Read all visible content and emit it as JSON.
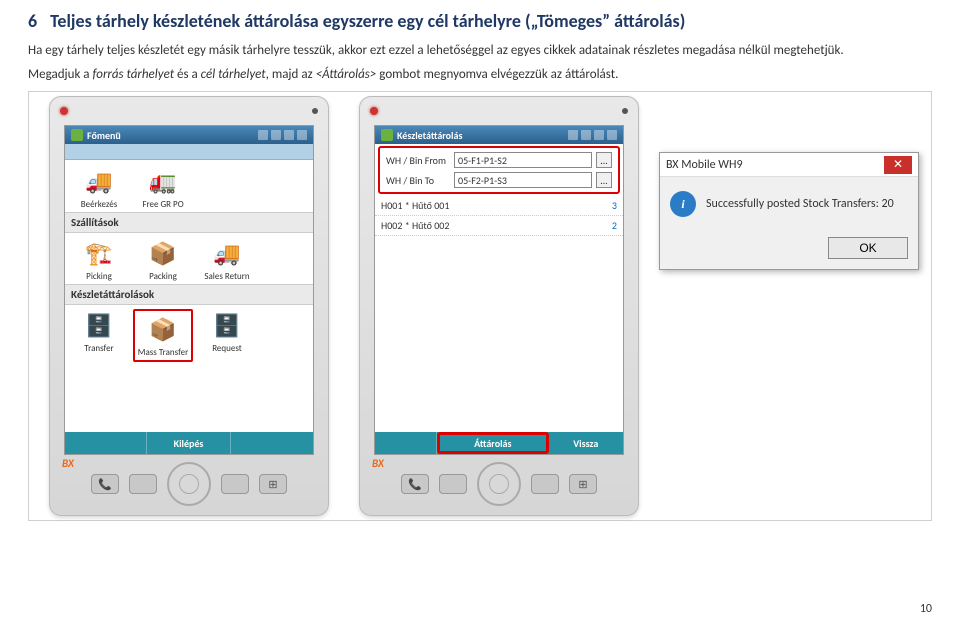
{
  "heading_num": "6",
  "heading_text": "Teljes tárhely készletének áttárolása egyszerre egy cél tárhelyre („Tömeges” áttárolás)",
  "para1": "Ha egy tárhely teljes készletét egy másik tárhelyre tesszük, akkor ezt ezzel a lehetőséggel az egyes cikkek adatainak részletes megadása nélkül megtehetjük.",
  "para2_a": "Megadjuk a ",
  "para2_i": "forrás tárhelyet",
  "para2_b": " és a ",
  "para2_j": "cél tárhelyet",
  "para2_c": ", majd az ",
  "para2_k": "<Áttárolás>",
  "para2_d": " gombot megnyomva elvégezzük az áttárolást.",
  "page_number": "10",
  "pda1": {
    "title": "Főmenü",
    "sections": {
      "row1": [
        {
          "label": "Beérkezés"
        },
        {
          "label": "Free GR PO"
        }
      ],
      "szall_head": "Szállítások",
      "row2": [
        {
          "label": "Picking"
        },
        {
          "label": "Packing"
        },
        {
          "label": "Sales Return"
        }
      ],
      "keszlet_head": "Készletáttárolások",
      "row3": [
        {
          "label": "Transfer"
        },
        {
          "label": "Mass Transfer"
        },
        {
          "label": "Request"
        }
      ]
    },
    "footer": {
      "exit": "Kilépés"
    }
  },
  "pda2": {
    "title": "Készletáttárolás",
    "form": {
      "from_label": "WH / Bin From",
      "from_value": "05-F1-P1-S2",
      "to_label": "WH / Bin To",
      "to_value": "05-F2-P1-S3"
    },
    "list": [
      {
        "name": "H001 * Hűtő 001",
        "qty": "3"
      },
      {
        "name": "H002 * Hűtő 002",
        "qty": "2"
      }
    ],
    "footer": {
      "transfer": "Áttárolás",
      "back": "Vissza"
    }
  },
  "dialog": {
    "title": "BX Mobile WH9",
    "message": "Successfully posted Stock Transfers: 20",
    "ok": "OK"
  }
}
